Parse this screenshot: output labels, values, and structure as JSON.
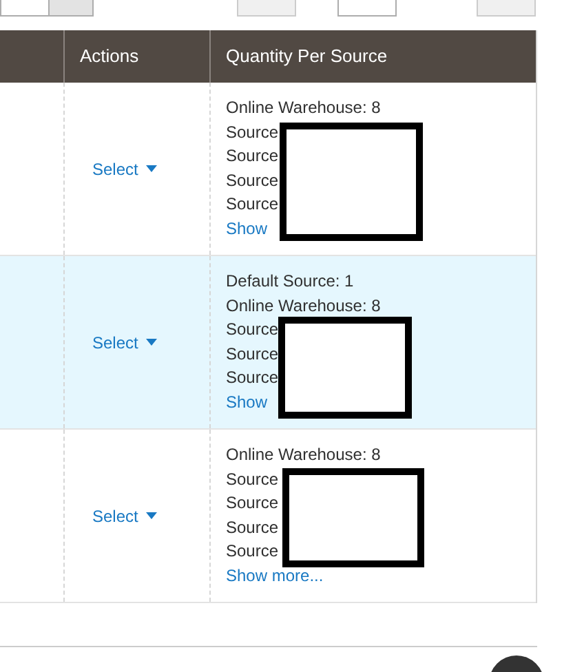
{
  "table": {
    "columns": [
      "Actions",
      "Quantity Per Source"
    ],
    "rows": [
      {
        "selected": false,
        "action": "Select",
        "sources": [
          "Online Warehouse: 8",
          "Source",
          "Source",
          "Source",
          "Source"
        ],
        "show_more": "Show"
      },
      {
        "selected": true,
        "action": "Select",
        "sources": [
          "Default Source: 1",
          "Online Warehouse: 8",
          "Source",
          "Source",
          "Source"
        ],
        "show_more": "Show"
      },
      {
        "selected": false,
        "action": "Select",
        "sources": [
          "Online Warehouse: 8",
          "Source",
          "Source",
          "Source",
          "Source"
        ],
        "show_more": "Show more..."
      }
    ]
  }
}
